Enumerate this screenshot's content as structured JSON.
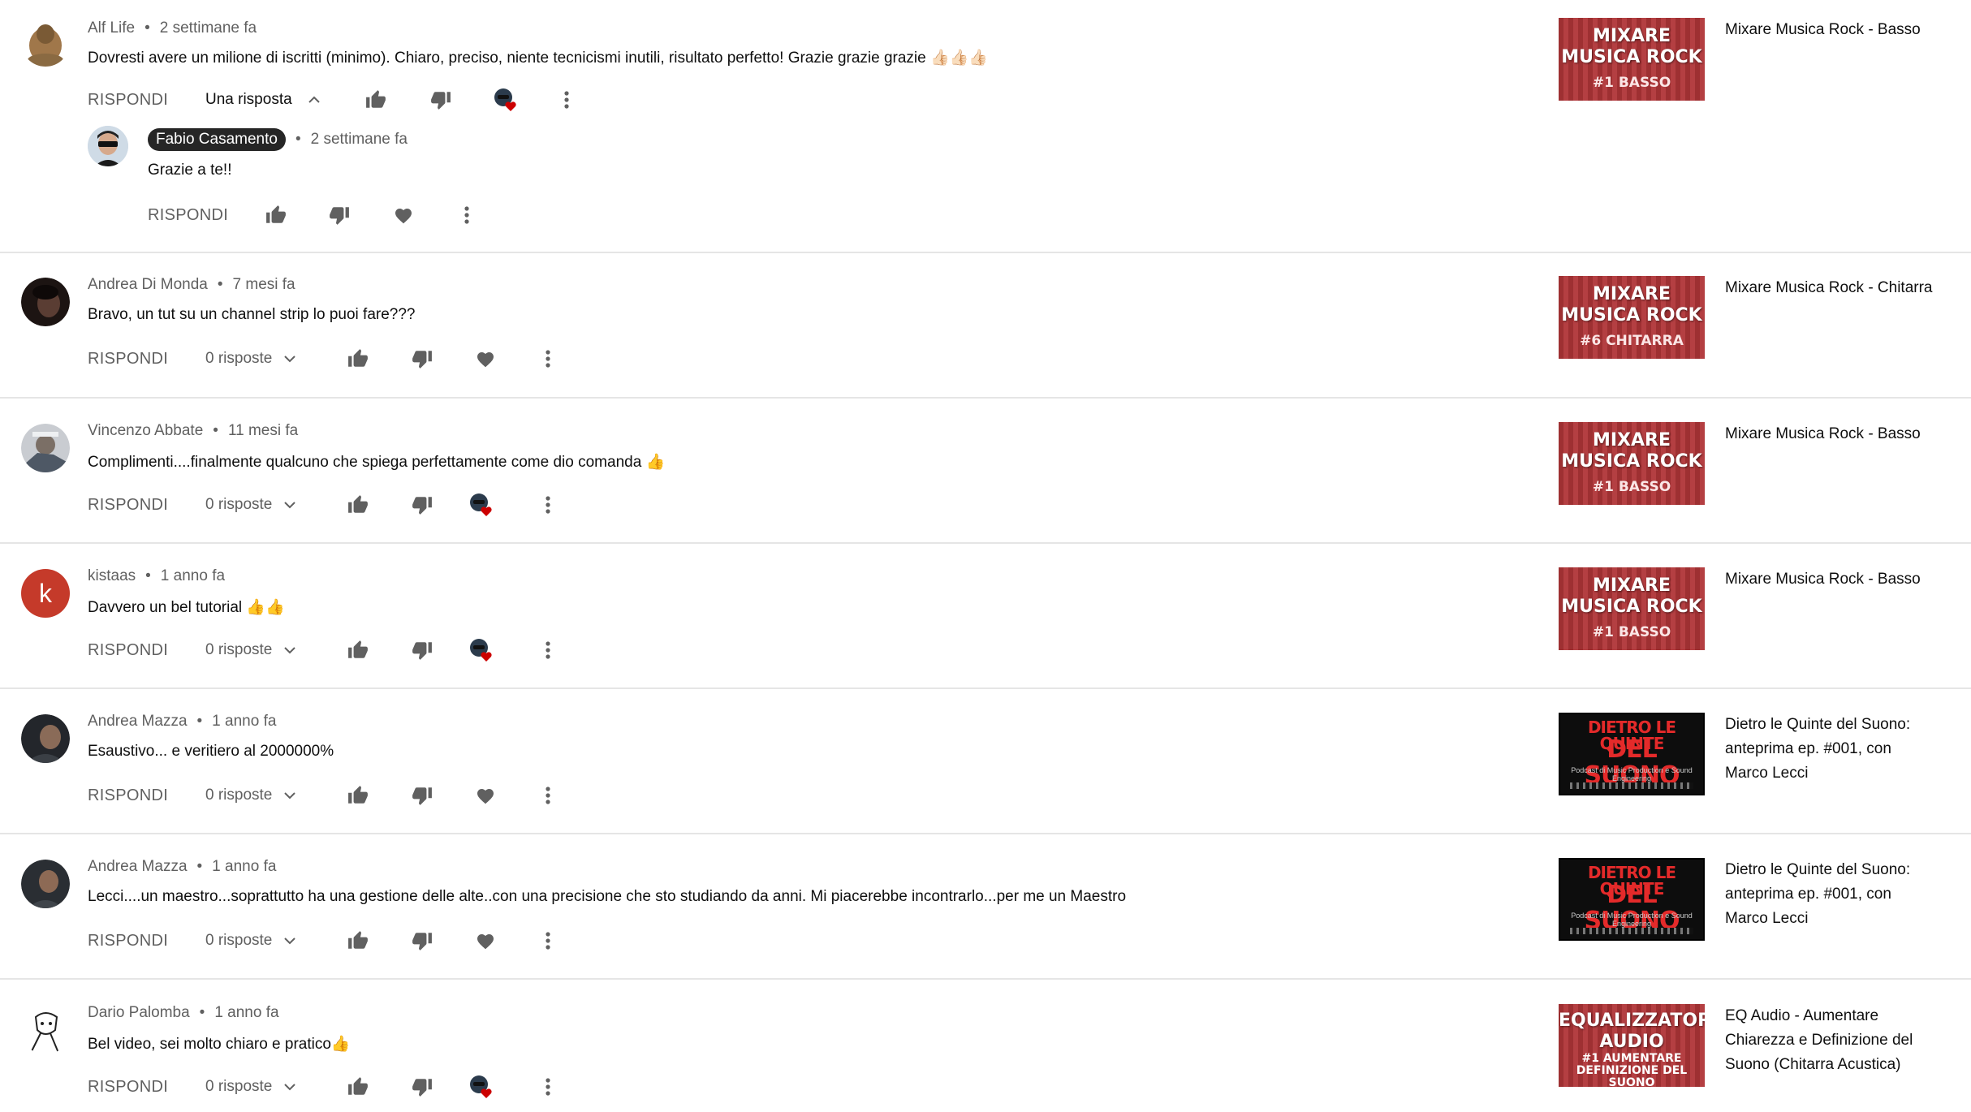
{
  "colors": {
    "accent_heart": "#cc0000",
    "text_secondary": "#606060",
    "avatar_k": "#c53a2a"
  },
  "icons": {
    "like": "thumb-up-icon",
    "dislike": "thumb-down-icon",
    "heart": "heart-icon",
    "creator_heart": "creator-heart-icon",
    "menu": "more-vert-icon",
    "chevron_up": "chevron-up-icon",
    "chevron_down": "chevron-down-icon"
  },
  "comments": [
    {
      "author": "Alf Life",
      "time": "2 settimane fa",
      "text": "Dovresti avere un milione di iscritti (minimo). Chiaro, preciso, niente tecnicismi inutili, risultato perfetto!  Grazie grazie grazie 👍🏻👍🏻👍🏻",
      "reply": "RISPONDI",
      "replies": "Una risposta",
      "hearted": true,
      "video": {
        "thumb_line1": "MIXARE",
        "thumb_line2": "MUSICA ROCK",
        "thumb_line3": "#1 BASSO",
        "title": "Mixare Musica Rock - Basso"
      }
    },
    {
      "author": "Andrea Di Monda",
      "time": "7 mesi fa",
      "text": "Bravo, un tut su un channel strip lo puoi fare???",
      "reply": "RISPONDI",
      "replies": "0 risposte",
      "hearted": false,
      "video": {
        "thumb_line1": "MIXARE",
        "thumb_line2": "MUSICA ROCK",
        "thumb_line3": "#6 CHITARRA",
        "title": "Mixare Musica Rock - Chitarra"
      }
    },
    {
      "author": "Vincenzo Abbate",
      "time": "11 mesi fa",
      "text": "Complimenti....finalmente qualcuno che spiega perfettamente come dio comanda 👍",
      "reply": "RISPONDI",
      "replies": "0 risposte",
      "hearted": true,
      "video": {
        "thumb_line1": "MIXARE",
        "thumb_line2": "MUSICA ROCK",
        "thumb_line3": "#1 BASSO",
        "title": "Mixare Musica Rock - Basso"
      }
    },
    {
      "author": "kistaas",
      "avatar_letter": "k",
      "time": "1 anno fa",
      "text": "Davvero un bel tutorial 👍👍",
      "reply": "RISPONDI",
      "replies": "0 risposte",
      "hearted": true,
      "video": {
        "thumb_line1": "MIXARE",
        "thumb_line2": "MUSICA ROCK",
        "thumb_line3": "#1 BASSO",
        "title": "Mixare Musica Rock - Basso"
      }
    },
    {
      "author": "Andrea Mazza",
      "time": "1 anno fa",
      "text": "Esaustivo... e veritiero al 2000000%",
      "reply": "RISPONDI",
      "replies": "0 risposte",
      "hearted": false,
      "video": {
        "thumb_line1": "DIETRO LE QUINTE",
        "thumb_line2": "DEL SUONO",
        "thumb_line3": "Podcast di Music Production e Sound Engineering",
        "title": "Dietro le Quinte del Suono: anteprima ep. #001, con Marco Lecci"
      }
    },
    {
      "author": "Andrea Mazza",
      "time": "1 anno fa",
      "text": "Lecci....un maestro...soprattutto ha una gestione delle alte..con una precisione che sto studiando da anni. Mi piacerebbe incontrarlo...per me un Maestro",
      "reply": "RISPONDI",
      "replies": "0 risposte",
      "hearted": false,
      "video": {
        "thumb_line1": "DIETRO LE QUINTE",
        "thumb_line2": "DEL SUONO",
        "thumb_line3": "Podcast di Music Production e Sound Engineering",
        "title": "Dietro le Quinte del Suono: anteprima ep. #001, con Marco Lecci"
      }
    },
    {
      "author": "Dario Palomba",
      "time": "1 anno fa",
      "text": "Bel video, sei molto chiaro e pratico👍",
      "reply": "RISPONDI",
      "replies": "0 risposte",
      "hearted": true,
      "video": {
        "thumb_line1": "EQUALIZZATORE",
        "thumb_line2": "AUDIO",
        "thumb_line3": "#1 AUMENTARE DEFINIZIONE DEL SUONO",
        "title": "EQ Audio - Aumentare Chiarezza e Definizione del Suono (Chitarra Acustica)"
      }
    }
  ],
  "nested_reply": {
    "author": "Fabio Casamento",
    "time": "2 settimane fa",
    "text": "Grazie a te!!",
    "reply": "RISPONDI"
  }
}
